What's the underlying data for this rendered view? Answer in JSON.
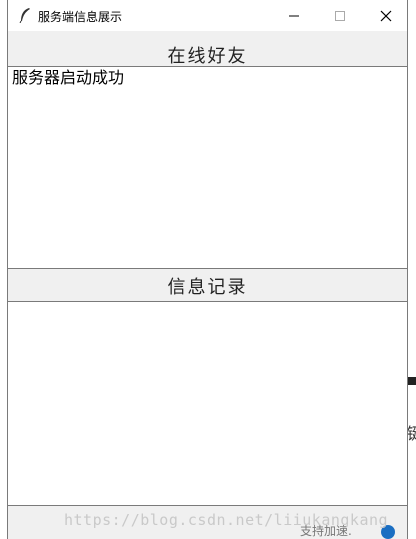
{
  "window": {
    "title": "服务端信息展示"
  },
  "sections": {
    "online_friends_label": "在线好友",
    "message_log_label": "信息记录"
  },
  "online_list": {
    "items": [
      "服务器启动成功"
    ]
  },
  "message_log": {
    "items": []
  },
  "background": {
    "glyph": "键",
    "partial_text": "支持加速."
  },
  "watermark": "https://blog.csdn.net/liiukangkang"
}
